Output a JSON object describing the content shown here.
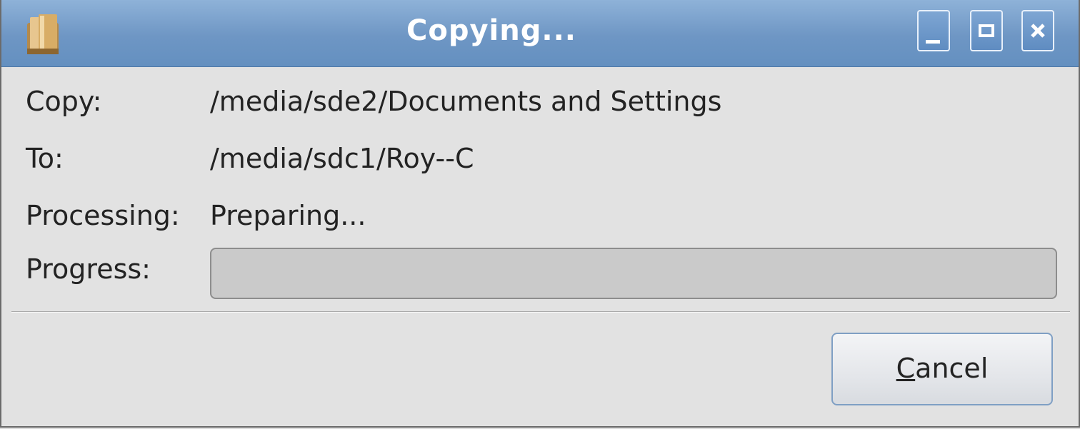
{
  "window": {
    "title": "Copying...",
    "controls": {
      "minimize_icon": "minimize-icon",
      "maximize_icon": "maximize-icon",
      "close_icon": "close-icon"
    },
    "app_icon": "folder-icon"
  },
  "details": {
    "copy_label": "Copy:",
    "copy_value": "/media/sde2/Documents and Settings",
    "to_label": "To:",
    "to_value": "/media/sdc1/Roy--C",
    "processing_label": "Processing:",
    "processing_value": "Preparing...",
    "progress_label": "Progress:",
    "progress_fraction": 0
  },
  "buttons": {
    "cancel_mnemonic": "C",
    "cancel_rest": "ancel"
  },
  "colors": {
    "titlebar": "#6e96c4",
    "progress_trough": "#cacaca",
    "progress_fill": "#6f97c6",
    "button_border": "#7f9fc4"
  }
}
